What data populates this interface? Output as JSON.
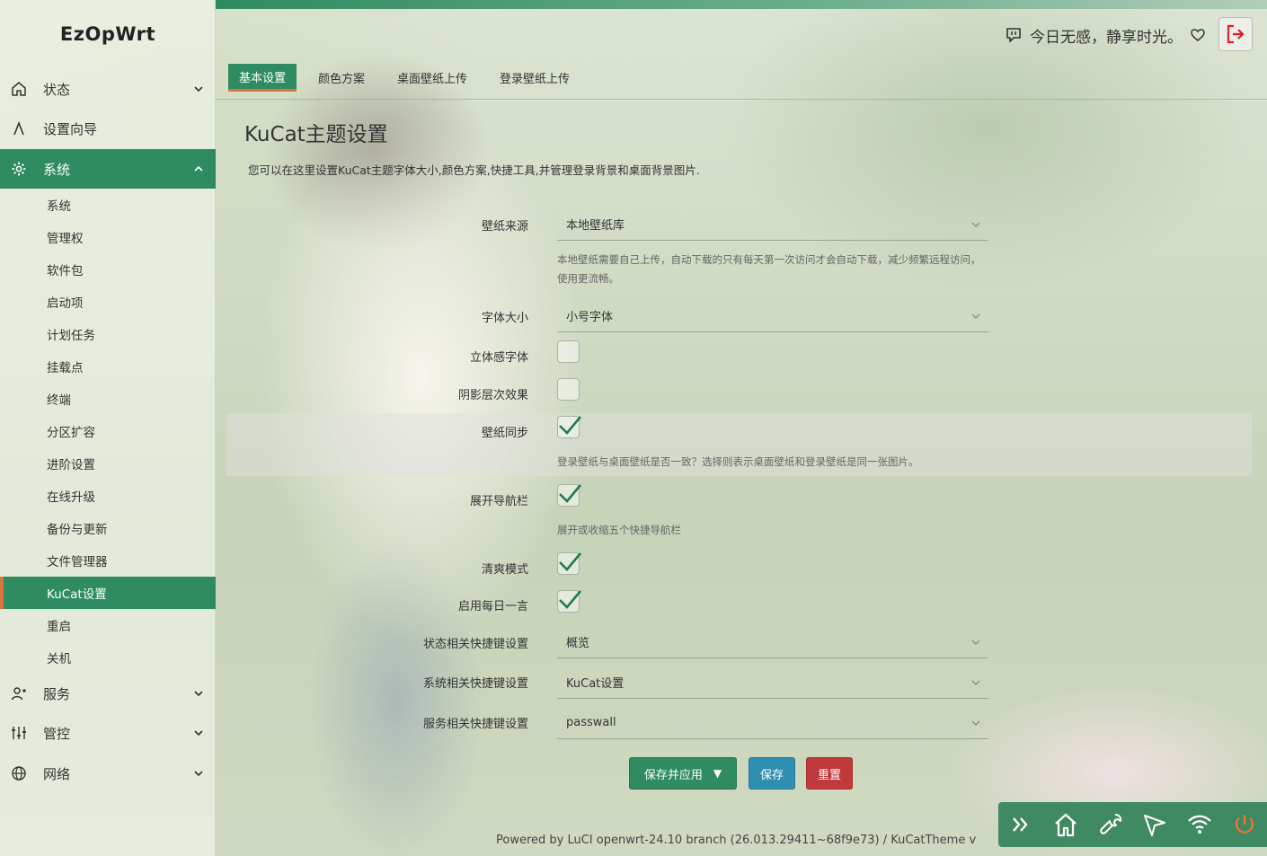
{
  "brand": "EzOpWrt",
  "header": {
    "motto": "今日无感，静享时光。"
  },
  "sidebar": {
    "items": [
      {
        "label": "状态"
      },
      {
        "label": "设置向导"
      },
      {
        "label": "系统"
      },
      {
        "label": "服务"
      },
      {
        "label": "管控"
      },
      {
        "label": "网络"
      }
    ],
    "system_sub": [
      {
        "label": "系统"
      },
      {
        "label": "管理权"
      },
      {
        "label": "软件包"
      },
      {
        "label": "启动项"
      },
      {
        "label": "计划任务"
      },
      {
        "label": "挂载点"
      },
      {
        "label": "终端"
      },
      {
        "label": "分区扩容"
      },
      {
        "label": "进阶设置"
      },
      {
        "label": "在线升级"
      },
      {
        "label": "备份与更新"
      },
      {
        "label": "文件管理器"
      },
      {
        "label": "KuCat设置"
      },
      {
        "label": "重启"
      },
      {
        "label": "关机"
      }
    ]
  },
  "tabs": [
    {
      "label": "基本设置"
    },
    {
      "label": "颜色方案"
    },
    {
      "label": "桌面壁纸上传"
    },
    {
      "label": "登录壁纸上传"
    }
  ],
  "page": {
    "title": "KuCat主题设置",
    "description": "您可以在这里设置KuCat主题字体大小,颜色方案,快捷工具,并管理登录背景和桌面背景图片."
  },
  "form": {
    "wallpaper_source": {
      "label": "壁纸来源",
      "value": "本地壁纸库",
      "hint": "本地壁纸需要自己上传，自动下载的只有每天第一次访问才会自动下载，减少频繁远程访问，使用更流畅。"
    },
    "font_size": {
      "label": "字体大小",
      "value": "小号字体"
    },
    "font_3d": {
      "label": "立体感字体",
      "checked": false
    },
    "shadow_effect": {
      "label": "阴影层次效果",
      "checked": false
    },
    "wallpaper_sync": {
      "label": "壁纸同步",
      "checked": true,
      "hint": "登录壁纸与桌面壁纸是否一致？选择则表示桌面壁纸和登录壁纸是同一张图片。"
    },
    "expand_nav": {
      "label": "展开导航栏",
      "checked": true,
      "hint": "展开或收缩五个快捷导航栏"
    },
    "clean_mode": {
      "label": "清爽模式",
      "checked": true
    },
    "daily_quote": {
      "label": "启用每日一言",
      "checked": true
    },
    "status_shortcut": {
      "label": "状态相关快捷键设置",
      "value": "概览"
    },
    "system_shortcut": {
      "label": "系统相关快捷键设置",
      "value": "KuCat设置"
    },
    "service_shortcut": {
      "label": "服务相关快捷键设置",
      "value": "passwall"
    }
  },
  "buttons": {
    "save_apply": "保存并应用",
    "save": "保存",
    "reset": "重置"
  },
  "footer": "Powered by LuCI openwrt-24.10 branch (26.013.29411~68f9e73)  /  KuCatTheme v",
  "quickbar": {
    "icons": [
      "double-chevron-right-icon",
      "home-icon",
      "wrench-icon",
      "send-icon",
      "wifi-icon",
      "power-icon"
    ]
  },
  "colors": {
    "accent": "#2e8b62",
    "indicator": "#d9763f",
    "save_button": "#2f8fb0",
    "reset_button": "#c0393b",
    "logout_icon": "#e02020",
    "power_icon": "#e8762f"
  }
}
